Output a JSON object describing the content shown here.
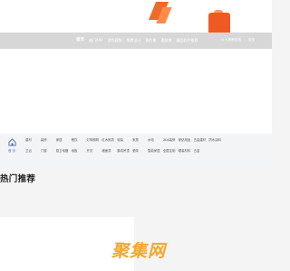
{
  "nav": {
    "items": [
      "首页",
      "热门APP",
      "游戏视频",
      "免费设计",
      "图片集",
      "素材库",
      "精品软件推荐"
    ],
    "search": [
      "Q 大家都在搜",
      "登录"
    ]
  },
  "category_bar": {
    "home_label": "首 页",
    "items": [
      "建材",
      "装修",
      "家居",
      "餐饮",
      "灯饰照明",
      "红木家具",
      "软装",
      "家居",
      "水电",
      "冰冰装修",
      "家纺用品",
      "五金建材",
      "防水涂料",
      "",
      "",
      "",
      "卫浴",
      "门窗",
      "厨卫电器",
      "地板",
      "开关",
      "墙面漆",
      "集成吊顶",
      "瓷砖",
      "智能家居",
      "全屋定制",
      "硬装材料",
      "五金",
      "",
      "",
      "",
      ""
    ]
  },
  "section": {
    "title": "热门推荐"
  },
  "watermark": {
    "text": "聚集网"
  },
  "colors": {
    "accent_orange": "#f06a2a",
    "nav_bg": "#d7d7d7",
    "watermark": "#f0a830"
  }
}
